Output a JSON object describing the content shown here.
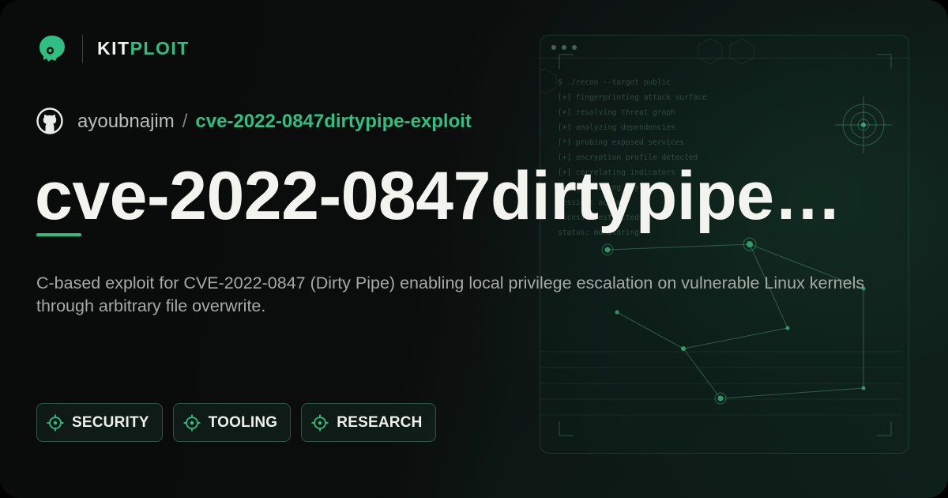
{
  "brand": {
    "name_part1": "KIT",
    "name_part2": "PLOIT",
    "accent_color": "#2fbf82",
    "logo_icon": "kitploit-hacker-head-icon"
  },
  "repo": {
    "icon": "github-icon",
    "owner": "ayoubnajim",
    "separator": "/",
    "name": "cve-2022-0847dirtypipe-exploit"
  },
  "title": "cve-2022-0847dirtypipe…",
  "description": "C-based exploit for CVE-2022-0847 (Dirty Pipe) enabling local privilege escalation on vulnerable Linux kernels through arbitrary file overwrite.",
  "tags": [
    {
      "label": "SECURITY",
      "icon": "crosshair-icon"
    },
    {
      "label": "TOOLING",
      "icon": "crosshair-icon"
    },
    {
      "label": "RESEARCH",
      "icon": "crosshair-icon"
    }
  ],
  "terminal": {
    "lines": [
      "$ ./recon --target public",
      "[+] fingerprinting attack surface",
      "[+] resolving threat graph",
      "[+] analyzing dependencies",
      "[*] probing exposed services",
      "[+] encryption profile detected",
      "[+] correlating indicators",
      "[+] generating payload",
      "session: active",
      "access: restricted",
      "status: monitoring"
    ]
  }
}
